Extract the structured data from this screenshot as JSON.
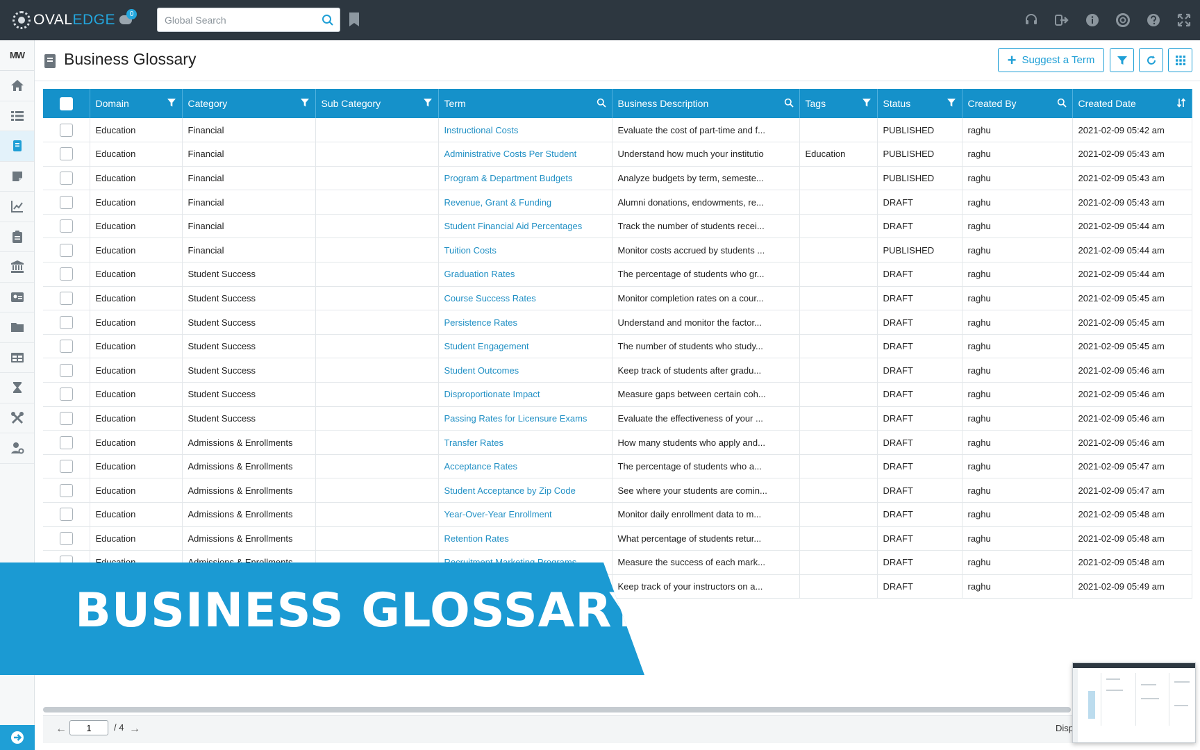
{
  "app": {
    "logo_text_main": "OVAL",
    "logo_text_accent": "EDGE",
    "chat_badge": "0"
  },
  "search": {
    "placeholder": "Global Search"
  },
  "sidebar": {
    "user_initials": "MW"
  },
  "page": {
    "title": "Business Glossary",
    "suggest_label": "Suggest a Term"
  },
  "table": {
    "columns": [
      "Domain",
      "Category",
      "Sub Category",
      "Term",
      "Business Description",
      "Tags",
      "Status",
      "Created By",
      "Created Date"
    ],
    "rows": [
      {
        "domain": "Education",
        "category": "Financial",
        "sub_category": "",
        "term": "Instructional Costs",
        "description": "Evaluate the cost of part-time and f...",
        "tags": "",
        "status": "PUBLISHED",
        "created_by": "raghu",
        "created_date": "2021-02-09 05:42 am"
      },
      {
        "domain": "Education",
        "category": "Financial",
        "sub_category": "",
        "term": "Administrative Costs Per Student",
        "description": "Understand how much your institutio",
        "tags": "Education",
        "status": "PUBLISHED",
        "created_by": "raghu",
        "created_date": "2021-02-09 05:43 am"
      },
      {
        "domain": "Education",
        "category": "Financial",
        "sub_category": "",
        "term": "Program & Department Budgets",
        "description": "Analyze budgets by term, semeste...",
        "tags": "",
        "status": "PUBLISHED",
        "created_by": "raghu",
        "created_date": "2021-02-09 05:43 am"
      },
      {
        "domain": "Education",
        "category": "Financial",
        "sub_category": "",
        "term": "Revenue, Grant & Funding",
        "description": "Alumni donations, endowments, re...",
        "tags": "",
        "status": "DRAFT",
        "created_by": "raghu",
        "created_date": "2021-02-09 05:43 am"
      },
      {
        "domain": "Education",
        "category": "Financial",
        "sub_category": "",
        "term": "Student Financial Aid Percentages",
        "description": "Track the number of students recei...",
        "tags": "",
        "status": "DRAFT",
        "created_by": "raghu",
        "created_date": "2021-02-09 05:44 am"
      },
      {
        "domain": "Education",
        "category": "Financial",
        "sub_category": "",
        "term": "Tuition Costs",
        "description": "Monitor costs accrued by students ...",
        "tags": "",
        "status": "PUBLISHED",
        "created_by": "raghu",
        "created_date": "2021-02-09 05:44 am"
      },
      {
        "domain": "Education",
        "category": "Student Success",
        "sub_category": "",
        "term": "Graduation Rates",
        "description": "The percentage of students who gr...",
        "tags": "",
        "status": "DRAFT",
        "created_by": "raghu",
        "created_date": "2021-02-09 05:44 am"
      },
      {
        "domain": "Education",
        "category": "Student Success",
        "sub_category": "",
        "term": "Course Success Rates",
        "description": "Monitor completion rates on a cour...",
        "tags": "",
        "status": "DRAFT",
        "created_by": "raghu",
        "created_date": "2021-02-09 05:45 am"
      },
      {
        "domain": "Education",
        "category": "Student Success",
        "sub_category": "",
        "term": "Persistence Rates",
        "description": "Understand and monitor the factor...",
        "tags": "",
        "status": "DRAFT",
        "created_by": "raghu",
        "created_date": "2021-02-09 05:45 am"
      },
      {
        "domain": "Education",
        "category": "Student Success",
        "sub_category": "",
        "term": "Student Engagement",
        "description": "The number of students who study...",
        "tags": "",
        "status": "DRAFT",
        "created_by": "raghu",
        "created_date": "2021-02-09 05:45 am"
      },
      {
        "domain": "Education",
        "category": "Student Success",
        "sub_category": "",
        "term": "Student Outcomes",
        "description": "Keep track of students after gradu...",
        "tags": "",
        "status": "DRAFT",
        "created_by": "raghu",
        "created_date": "2021-02-09 05:46 am"
      },
      {
        "domain": "Education",
        "category": "Student Success",
        "sub_category": "",
        "term": "Disproportionate Impact",
        "description": "Measure gaps between certain coh...",
        "tags": "",
        "status": "DRAFT",
        "created_by": "raghu",
        "created_date": "2021-02-09 05:46 am"
      },
      {
        "domain": "Education",
        "category": "Student Success",
        "sub_category": "",
        "term": "Passing Rates for Licensure Exams",
        "description": "Evaluate the effectiveness of your ...",
        "tags": "",
        "status": "DRAFT",
        "created_by": "raghu",
        "created_date": "2021-02-09 05:46 am"
      },
      {
        "domain": "Education",
        "category": "Admissions & Enrollments",
        "sub_category": "",
        "term": "Transfer Rates",
        "description": "How many students who apply and...",
        "tags": "",
        "status": "DRAFT",
        "created_by": "raghu",
        "created_date": "2021-02-09 05:46 am"
      },
      {
        "domain": "Education",
        "category": "Admissions & Enrollments",
        "sub_category": "",
        "term": "Acceptance Rates",
        "description": "The percentage of students who a...",
        "tags": "",
        "status": "DRAFT",
        "created_by": "raghu",
        "created_date": "2021-02-09 05:47 am"
      },
      {
        "domain": "Education",
        "category": "Admissions & Enrollments",
        "sub_category": "",
        "term": "Student Acceptance by Zip Code",
        "description": "See where your students are comin...",
        "tags": "",
        "status": "DRAFT",
        "created_by": "raghu",
        "created_date": "2021-02-09 05:47 am"
      },
      {
        "domain": "Education",
        "category": "Admissions & Enrollments",
        "sub_category": "",
        "term": "Year-Over-Year Enrollment",
        "description": "Monitor daily enrollment data to m...",
        "tags": "",
        "status": "DRAFT",
        "created_by": "raghu",
        "created_date": "2021-02-09 05:48 am"
      },
      {
        "domain": "Education",
        "category": "Admissions & Enrollments",
        "sub_category": "",
        "term": "Retention Rates",
        "description": "What percentage of students retur...",
        "tags": "",
        "status": "DRAFT",
        "created_by": "raghu",
        "created_date": "2021-02-09 05:48 am"
      },
      {
        "domain": "Education",
        "category": "Admissions & Enrollments",
        "sub_category": "",
        "term": "Recruitment Marketing Programs",
        "description": "Measure the success of each mark...",
        "tags": "",
        "status": "DRAFT",
        "created_by": "raghu",
        "created_date": "2021-02-09 05:48 am"
      },
      {
        "domain": "",
        "category": "",
        "sub_category": "",
        "term": "",
        "description": "Keep track of your instructors on a...",
        "tags": "",
        "status": "DRAFT",
        "created_by": "raghu",
        "created_date": "2021-02-09 05:49 am"
      }
    ]
  },
  "pager": {
    "current_page": "1",
    "total": "/ 4",
    "display_label": "Disp"
  },
  "banner": {
    "text": "BUSINESS GLOSSARY"
  },
  "colors": {
    "topbar": "#2d3740",
    "accent": "#1f9fd6",
    "header_blue": "#1591ca",
    "term_link": "#1f8fc4",
    "banner": "#1b9ad3"
  }
}
